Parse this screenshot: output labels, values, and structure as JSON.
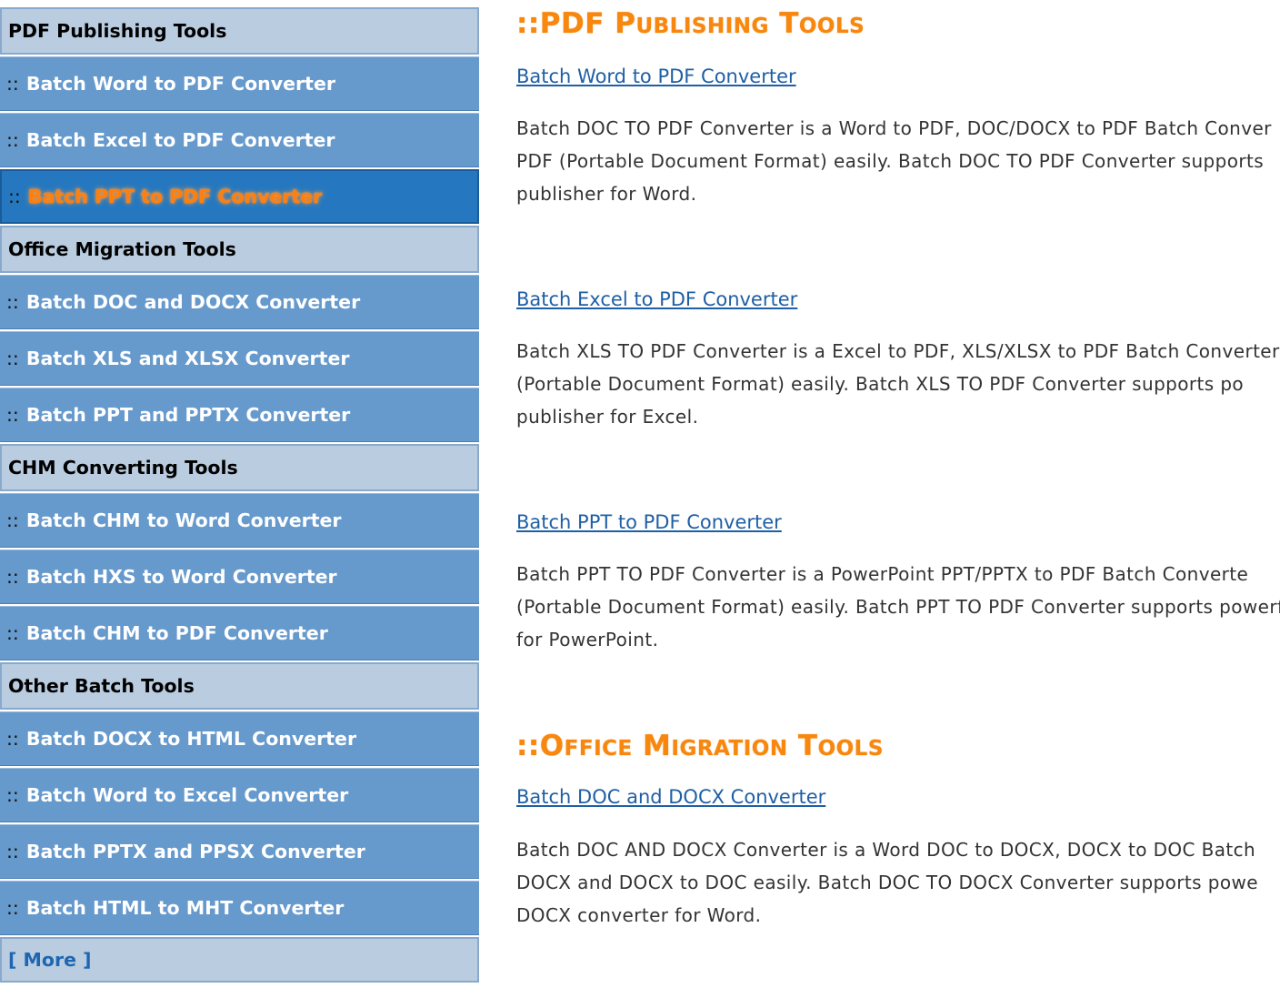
{
  "sidebar": {
    "groups": [
      {
        "header": "PDF Publishing Tools",
        "items": [
          {
            "sep": "::",
            "label": "Batch Word to PDF Converter"
          },
          {
            "sep": "::",
            "label": "Batch Excel to PDF Converter"
          },
          {
            "sep": "::",
            "label": "Batch PPT to PDF Converter"
          }
        ]
      },
      {
        "header": "Office Migration Tools",
        "items": [
          {
            "sep": "::",
            "label": "Batch DOC and DOCX Converter"
          },
          {
            "sep": "::",
            "label": "Batch XLS and XLSX Converter"
          },
          {
            "sep": "::",
            "label": "Batch PPT and PPTX Converter"
          }
        ]
      },
      {
        "header": "CHM Converting Tools",
        "items": [
          {
            "sep": "::",
            "label": "Batch CHM to Word Converter"
          },
          {
            "sep": "::",
            "label": "Batch HXS to Word Converter"
          },
          {
            "sep": "::",
            "label": "Batch CHM to PDF Converter"
          }
        ]
      },
      {
        "header": "Other Batch Tools",
        "items": [
          {
            "sep": "::",
            "label": "Batch DOCX to HTML Converter"
          },
          {
            "sep": "::",
            "label": "Batch Word to Excel Converter"
          },
          {
            "sep": "::",
            "label": "Batch PPTX and PPSX Converter"
          },
          {
            "sep": "::",
            "label": "Batch HTML to MHT Converter"
          }
        ]
      }
    ],
    "more_label": "[ More ]"
  },
  "main": {
    "sections": [
      {
        "title_prefix": "::",
        "title_parts": [
          [
            "P",
            "DF"
          ],
          [
            "P",
            "UBLISHING"
          ],
          [
            "T",
            "OOLS"
          ]
        ],
        "products": [
          {
            "link": "Batch Word to PDF Converter",
            "lines": [
              "Batch DOC TO PDF Converter is a Word to PDF, DOC/DOCX to PDF Batch Conver",
              "PDF (Portable Document Format) easily. Batch DOC TO PDF Converter supports",
              "publisher for Word."
            ]
          },
          {
            "link": "Batch Excel to PDF Converter",
            "lines": [
              "Batch XLS TO PDF Converter is a Excel to PDF, XLS/XLSX to PDF Batch Converter",
              "(Portable  Document  Format)  easily.  Batch  XLS  TO  PDF  Converter  supports  po",
              "publisher for Excel."
            ]
          },
          {
            "link": "Batch PPT to PDF Converter",
            "lines": [
              "Batch  PPT  TO  PDF  Converter  is  a  PowerPoint  PPT/PPTX  to  PDF  Batch  Converte",
              "(Portable Document Format) easily. Batch PPT TO PDF Converter supports powerfu",
              "for PowerPoint."
            ]
          }
        ]
      },
      {
        "title_prefix": "::",
        "title_parts": [
          [
            "O",
            "FFICE"
          ],
          [
            "M",
            "IGRATION"
          ],
          [
            "T",
            "OOLS"
          ]
        ],
        "products": [
          {
            "link": "Batch DOC and DOCX Converter",
            "lines": [
              "Batch DOC AND DOCX Converter is a Word DOC to DOCX, DOCX to DOC Batch",
              "DOCX and DOCX to DOC easily. Batch DOC TO DOCX Converter supports powe",
              "DOCX converter for Word."
            ]
          }
        ]
      }
    ]
  },
  "colors": {
    "accent": "#f7870e",
    "link": "#1f5fa5",
    "sidebar_item": "#6699cc",
    "sidebar_header": "#b9cce0",
    "active": "#2578c0"
  }
}
